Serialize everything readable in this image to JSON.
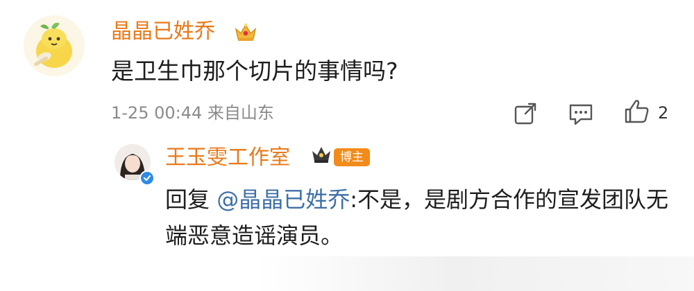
{
  "comment": {
    "user_name": "晶晶已姓乔",
    "text": "是卫生巾那个切片的事情吗?",
    "time": "1-25 00:44",
    "source": "来自山东",
    "like_count": "2",
    "icons": [
      "avatar",
      "crown-icon",
      "share-icon",
      "reply-icon",
      "like-icon"
    ]
  },
  "reply": {
    "user_name": "王玉雯工作室",
    "badge": "博主",
    "prefix": "回复 ",
    "mention": "@晶晶已姓乔",
    "text": ":不是，是剧方合作的宣发团队无端恶意造谣演员。",
    "icons": [
      "avatar",
      "verified-icon",
      "crown-icon"
    ]
  },
  "colors": {
    "name": "#e8791a",
    "mention": "#3e6fa6",
    "meta": "#8a8a8a",
    "badge": "#f28b1a",
    "verified": "#2f8be6"
  }
}
